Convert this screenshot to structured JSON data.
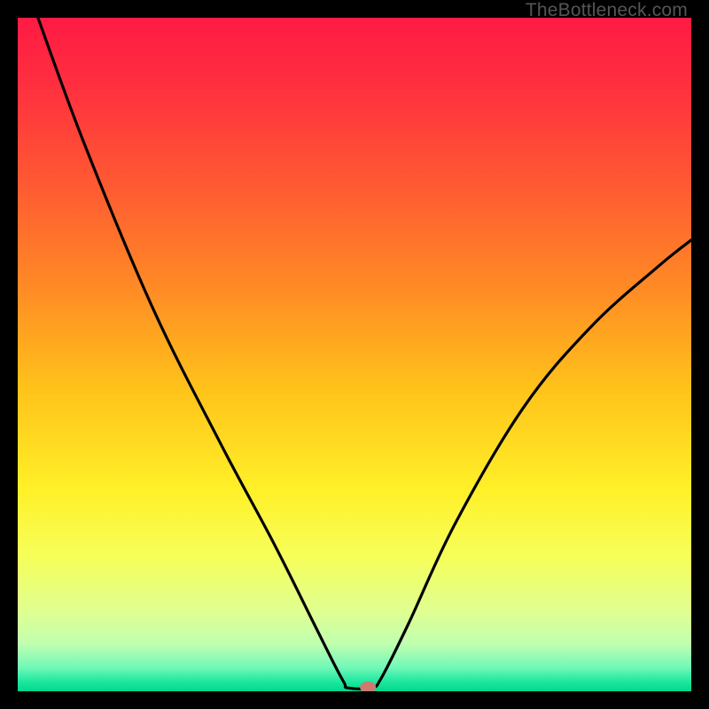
{
  "watermark": "TheBottleneck.com",
  "chart_data": {
    "type": "line",
    "title": "",
    "xlabel": "",
    "ylabel": "",
    "xlim": [
      0,
      100
    ],
    "ylim": [
      0,
      100
    ],
    "curve_left": [
      {
        "x": 3,
        "y": 100
      },
      {
        "x": 10,
        "y": 81
      },
      {
        "x": 20,
        "y": 57
      },
      {
        "x": 30,
        "y": 37
      },
      {
        "x": 38,
        "y": 22
      },
      {
        "x": 44,
        "y": 10
      },
      {
        "x": 47,
        "y": 4
      },
      {
        "x": 48.5,
        "y": 1.2
      },
      {
        "x": 49,
        "y": 0.5
      }
    ],
    "flat_bottom": [
      {
        "x": 49,
        "y": 0.5
      },
      {
        "x": 52.5,
        "y": 0.5
      }
    ],
    "curve_right": [
      {
        "x": 52.5,
        "y": 0.5
      },
      {
        "x": 54,
        "y": 2
      },
      {
        "x": 58,
        "y": 10
      },
      {
        "x": 65,
        "y": 25
      },
      {
        "x": 75,
        "y": 42
      },
      {
        "x": 85,
        "y": 54
      },
      {
        "x": 95,
        "y": 63
      },
      {
        "x": 100,
        "y": 67
      }
    ],
    "marker": {
      "x": 52,
      "y": 0.6
    },
    "gradient_stops": [
      {
        "offset": 0.0,
        "color": "#ff1a44"
      },
      {
        "offset": 0.1,
        "color": "#ff2f3f"
      },
      {
        "offset": 0.25,
        "color": "#ff5a32"
      },
      {
        "offset": 0.4,
        "color": "#ff8a25"
      },
      {
        "offset": 0.55,
        "color": "#ffc21a"
      },
      {
        "offset": 0.7,
        "color": "#fff028"
      },
      {
        "offset": 0.8,
        "color": "#f6ff5a"
      },
      {
        "offset": 0.88,
        "color": "#e0ff90"
      },
      {
        "offset": 0.93,
        "color": "#c0ffb0"
      },
      {
        "offset": 0.965,
        "color": "#70f8b8"
      },
      {
        "offset": 0.985,
        "color": "#20e8a0"
      },
      {
        "offset": 1.0,
        "color": "#00d88c"
      }
    ]
  }
}
